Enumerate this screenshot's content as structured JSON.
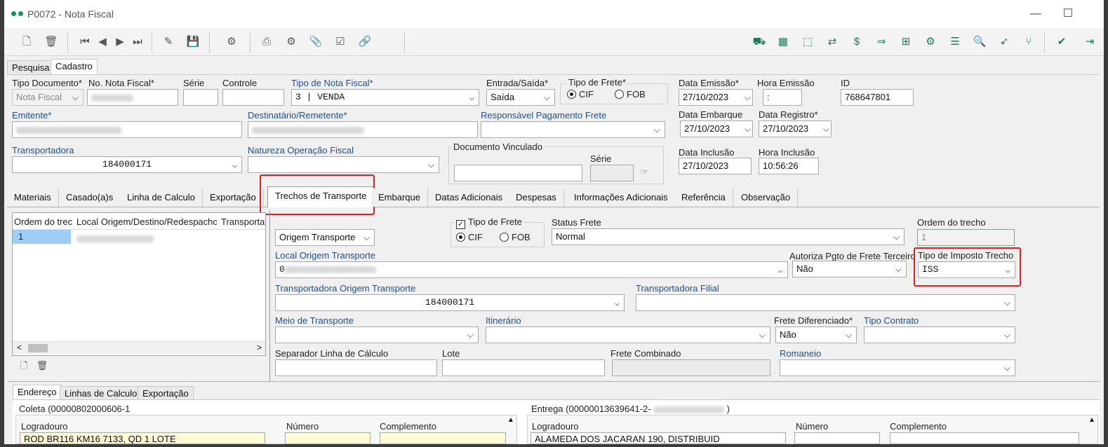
{
  "window": {
    "title": "P0072 - Nota Fiscal",
    "minimize": "—",
    "maximize": "☐"
  },
  "toolbar_left": [
    {
      "name": "new-doc-icon",
      "glyph": "🗋"
    },
    {
      "name": "delete-icon",
      "glyph": "🗑"
    },
    {
      "name": "first-record-icon",
      "glyph": "⏮"
    },
    {
      "name": "prev-record-icon",
      "glyph": "◀"
    },
    {
      "name": "next-record-icon",
      "glyph": "▶"
    },
    {
      "name": "last-record-icon",
      "glyph": "⏭"
    },
    {
      "name": "edit-icon",
      "glyph": "✎"
    },
    {
      "name": "save-icon",
      "glyph": "💾"
    },
    {
      "name": "process-icon",
      "glyph": "⚙"
    },
    {
      "name": "print-icon",
      "glyph": "⎙"
    },
    {
      "name": "settings-icon",
      "glyph": "⚙"
    },
    {
      "name": "attach-icon",
      "glyph": "📎"
    },
    {
      "name": "check-box-icon",
      "glyph": "☑"
    },
    {
      "name": "link-icon",
      "glyph": "🔗"
    }
  ],
  "toolbar_right": [
    {
      "name": "truck-icon",
      "glyph": "⛟"
    },
    {
      "name": "calc-icon",
      "glyph": "▦"
    },
    {
      "name": "box-icon",
      "glyph": "⬚"
    },
    {
      "name": "transfer-icon",
      "glyph": "⇄"
    },
    {
      "name": "money-icon",
      "glyph": "$"
    },
    {
      "name": "export-icon",
      "glyph": "⇒"
    },
    {
      "name": "tree-icon",
      "glyph": "⊞"
    },
    {
      "name": "gear-icon",
      "glyph": "⚙"
    },
    {
      "name": "list-icon",
      "glyph": "☰"
    },
    {
      "name": "search-doc-icon",
      "glyph": "🔍"
    },
    {
      "name": "send-icon",
      "glyph": "➶"
    },
    {
      "name": "branch-icon",
      "glyph": "⑂"
    },
    {
      "name": "confirm-icon",
      "glyph": "✔"
    },
    {
      "name": "exit-icon",
      "glyph": "⇥"
    }
  ],
  "top_tabs": {
    "pesquisa": "Pesquisa",
    "cadastro": "Cadastro"
  },
  "header": {
    "tipo_documento_label": "Tipo Documento*",
    "tipo_documento_value": "Nota Fiscal",
    "nota_fiscal_label": "No. Nota Fiscal*",
    "serie_label": "Série",
    "controle_label": "Controle",
    "tipo_nota_label": "Tipo de Nota Fiscal*",
    "tipo_nota_value": "3 | VENDA",
    "entrada_saida_label": "Entrada/Saída*",
    "entrada_saida_value": "Saída",
    "tipo_frete_label": "Tipo de Frete*",
    "cif": "CIF",
    "fob": "FOB",
    "data_emissao_label": "Data Emissão*",
    "data_emissao_value": "27/10/2023",
    "hora_emissao_label": "Hora Emissão",
    "hora_emissao_value": ":",
    "id_label": "ID",
    "id_value": "768647801",
    "emitente_label": "Emitente*",
    "destinatario_label": "Destinatário/Remetente*",
    "responsavel_label": "Responsável Pagamento Frete",
    "data_embarque_label": "Data Embarque",
    "data_embarque_value": "27/10/2023",
    "data_registro_label": "Data Registro*",
    "data_registro_value": "27/10/2023",
    "transportadora_label": "Transportadora",
    "transportadora_value": "184000171",
    "natureza_label": "Natureza Operação Fiscal",
    "documento_vinculado_label": "Documento Vinculado",
    "doc_serie_label": "Série",
    "data_inclusao_label": "Data Inclusão",
    "data_inclusao_value": "27/10/2023",
    "hora_inclusao_label": "Hora Inclusão",
    "hora_inclusao_value": "10:56:26"
  },
  "form_tabs": [
    "Materiais",
    "Casado(a)s",
    "Linha de Calculo",
    "Exportação",
    "Trechos de Transporte",
    "Embarque",
    "Datas Adicionais",
    "Despesas",
    "Informações Adicionais",
    "Referência",
    "Observação"
  ],
  "grid": {
    "columns": [
      "Ordem do trec",
      "Local Origem/Destino/Redespacho",
      "Transportad"
    ],
    "rows": [
      {
        "ordem": "1"
      }
    ]
  },
  "trecho": {
    "origem_value": "Origem Transporte",
    "tipo_frete_label": "Tipo de Frete",
    "cif": "CIF",
    "fob": "FOB",
    "status_frete_label": "Status Frete",
    "status_frete_value": "Normal",
    "ordem_trecho_label": "Ordem do trecho",
    "ordem_trecho_value": "1",
    "local_origem_label": "Local Origem Transporte",
    "local_origem_value": "0",
    "autoriza_label": "Autoriza Pgto de Frete Terceiro",
    "autoriza_value": "Não",
    "tipo_imposto_label": "Tipo de Imposto Trecho",
    "tipo_imposto_value": "ISS",
    "transp_origem_label": "Transportadora Origem Transporte",
    "transp_origem_value": "184000171",
    "transp_filial_label": "Transportadora Filial",
    "meio_label": "Meio de Transporte",
    "itinerario_label": "Itinerário",
    "frete_dif_label": "Frete Diferenciado*",
    "frete_dif_value": "Não",
    "tipo_contrato_label": "Tipo Contrato",
    "separador_label": "Separador Linha de Cálculo",
    "lote_label": "Lote",
    "frete_combinado_label": "Frete Combinado",
    "romaneio_label": "Romaneio"
  },
  "bottom_tabs": [
    "Endereço",
    "Linhas de Calculo",
    "Exportação"
  ],
  "coleta": {
    "title": "Coleta (00000802000606-1",
    "logradouro_label": "Logradouro",
    "logradouro_value": "ROD BR116 KM16 7133, QD 1 LOTE",
    "numero_label": "Número",
    "complemento_label": "Complemento"
  },
  "entrega": {
    "title": "Entrega (00000013639641-2-",
    "title_end": ")",
    "logradouro_label": "Logradouro",
    "logradouro_value": "ALAMEDA DOS JACARAN 190, DISTRIBUID",
    "numero_label": "Número",
    "complemento_label": "Complemento"
  }
}
